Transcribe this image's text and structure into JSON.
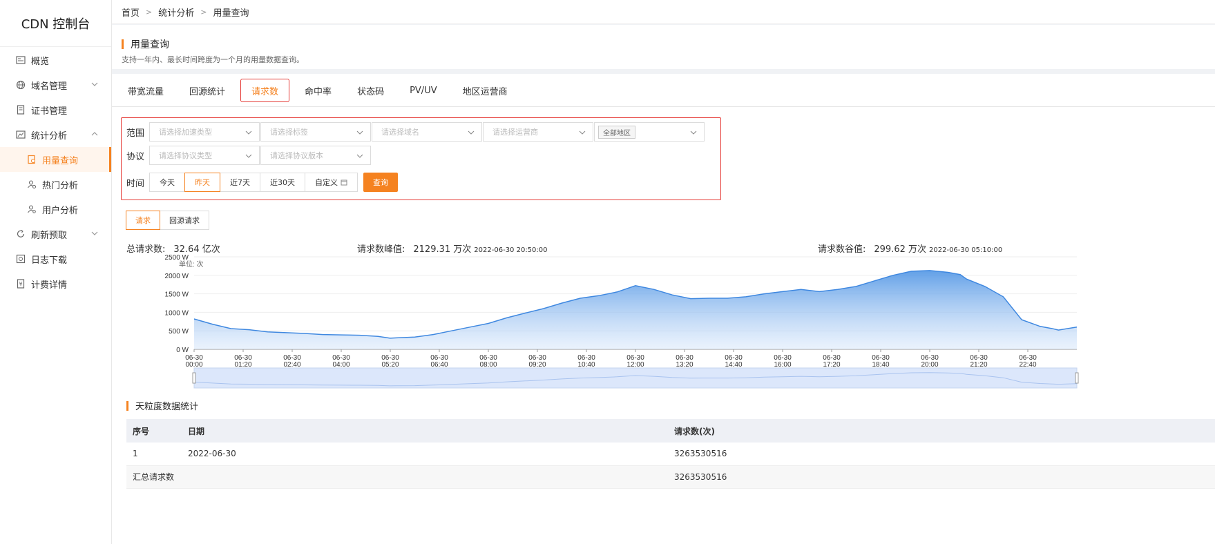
{
  "brand": "CDN 控制台",
  "sidebar": {
    "items": [
      {
        "label": "概览",
        "icon": "overview-icon"
      },
      {
        "label": "域名管理",
        "icon": "globe-icon"
      },
      {
        "label": "证书管理",
        "icon": "certificate-icon"
      },
      {
        "label": "统计分析",
        "icon": "chart-icon"
      },
      {
        "label": "用量查询",
        "icon": "usage-icon",
        "active": true
      },
      {
        "label": "热门分析",
        "icon": "user-search-icon"
      },
      {
        "label": "用户分析",
        "icon": "user-gear-icon"
      },
      {
        "label": "刷新预取",
        "icon": "refresh-icon"
      },
      {
        "label": "日志下载",
        "icon": "download-icon"
      },
      {
        "label": "计费详情",
        "icon": "billing-icon"
      }
    ]
  },
  "breadcrumb": [
    "首页",
    "统计分析",
    "用量查询"
  ],
  "header": {
    "title": "用量查询",
    "desc": "支持一年内、最长时间跨度为一个月的用量数据查询。"
  },
  "tabs": [
    "带宽流量",
    "回源统计",
    "请求数",
    "命中率",
    "状态码",
    "PV/UV",
    "地区运营商"
  ],
  "active_tab": "请求数",
  "filters": {
    "scope_label": "范围",
    "scope_placeholders": [
      "请选择加速类型",
      "请选择标签",
      "请选择域名",
      "请选择运营商"
    ],
    "region_tag": "全部地区",
    "protocol_label": "协议",
    "protocol_placeholders": [
      "请选择协议类型",
      "请选择协议版本"
    ],
    "time_label": "时间",
    "time_buttons": [
      "今天",
      "昨天",
      "近7天",
      "近30天",
      "自定义"
    ],
    "active_time": "昨天",
    "query_label": "查询"
  },
  "subtabs": [
    "请求",
    "回源请求"
  ],
  "stats": {
    "total_label": "总请求数:",
    "total_value": "32.64 亿次",
    "peak_label": "请求数峰值:",
    "peak_value": "2129.31 万次",
    "peak_time": "2022-06-30 20:50:00",
    "valley_label": "请求数谷值:",
    "valley_value": "299.62 万次",
    "valley_time": "2022-06-30 05:10:00"
  },
  "chart_data": {
    "type": "area",
    "unit_label": "单位: 次",
    "y_ticks": [
      "0 W",
      "500 W",
      "1000 W",
      "1500 W",
      "2000 W",
      "2500 W"
    ],
    "ylim": [
      0,
      2500
    ],
    "x_ticks": [
      "06-30\n00:00",
      "06-30\n01:20",
      "06-30\n02:40",
      "06-30\n04:00",
      "06-30\n05:20",
      "06-30\n06:40",
      "06-30\n08:00",
      "06-30\n09:20",
      "06-30\n10:40",
      "06-30\n12:00",
      "06-30\n13:20",
      "06-30\n14:40",
      "06-30\n16:00",
      "06-30\n17:20",
      "06-30\n18:40",
      "06-30\n20:00",
      "06-30\n21:20",
      "06-30\n22:40"
    ],
    "x_hours": [
      0,
      0.5,
      1,
      1.5,
      2,
      2.5,
      3,
      3.5,
      4,
      4.5,
      5,
      5.33,
      5.5,
      6,
      6.5,
      7,
      7.5,
      8,
      8.5,
      9,
      9.5,
      10,
      10.5,
      11,
      11.5,
      12,
      12.5,
      13,
      13.5,
      14,
      14.5,
      15,
      15.5,
      16,
      16.5,
      17,
      17.5,
      18,
      18.5,
      19,
      19.5,
      20,
      20.5,
      20.83,
      21,
      21.5,
      22,
      22.5,
      23,
      23.33,
      23.5,
      24
    ],
    "values": [
      820,
      680,
      560,
      530,
      470,
      450,
      430,
      400,
      390,
      380,
      350,
      300,
      310,
      330,
      400,
      500,
      600,
      700,
      850,
      980,
      1100,
      1250,
      1380,
      1450,
      1550,
      1720,
      1620,
      1470,
      1370,
      1380,
      1380,
      1420,
      1500,
      1560,
      1620,
      1560,
      1620,
      1700,
      1850,
      2000,
      2110,
      2129,
      2080,
      2020,
      1900,
      1700,
      1420,
      800,
      620,
      560,
      520,
      600
    ],
    "grid": true,
    "has_zoom_slider": true
  },
  "table": {
    "section_title": "天粒度数据统计",
    "headers": [
      "序号",
      "日期",
      "请求数(次)"
    ],
    "rows": [
      [
        "1",
        "2022-06-30",
        "3263530516"
      ]
    ],
    "summary": {
      "label": "汇总请求数",
      "value": "3263530516"
    }
  }
}
